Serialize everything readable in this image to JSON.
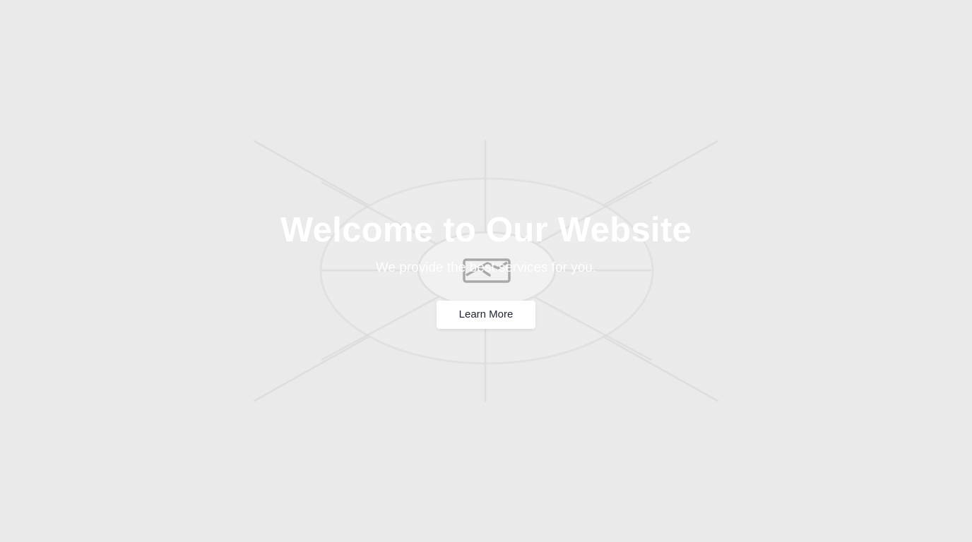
{
  "hero": {
    "title": "Welcome to Our Website",
    "subtitle": "We provide the best services for you.",
    "button_label": "Learn More",
    "background_icon": "broken-image-icon"
  },
  "colors": {
    "page_background": "#eaeaea",
    "title_text": "#ffffff",
    "button_background": "#ffffff",
    "button_text": "#1f2430"
  }
}
